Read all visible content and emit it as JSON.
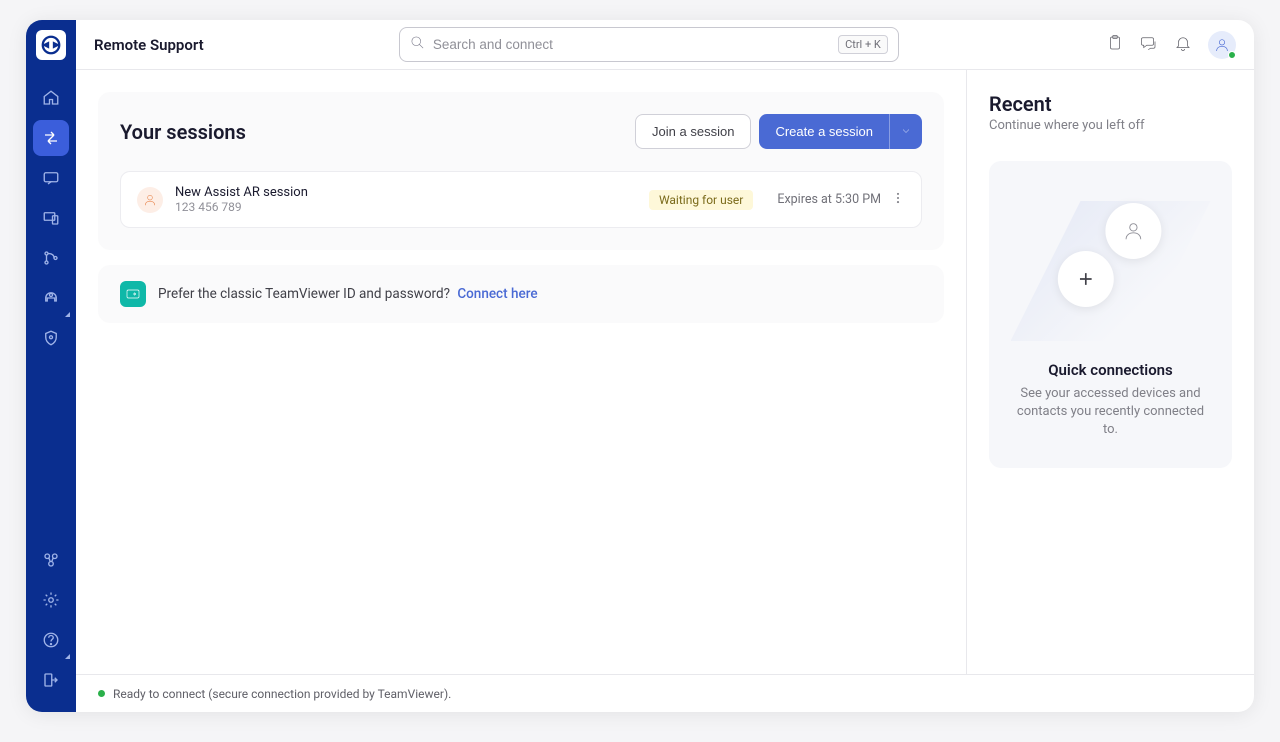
{
  "header": {
    "title": "Remote Support",
    "search_placeholder": "Search and connect",
    "shortcut": "Ctrl + K"
  },
  "sessions": {
    "title": "Your sessions",
    "join_label": "Join a session",
    "create_label": "Create a session",
    "items": [
      {
        "name": "New Assist AR session",
        "id": "123 456 789",
        "status": "Waiting for user",
        "expires": "Expires at 5:30 PM"
      }
    ]
  },
  "classic": {
    "prompt": "Prefer the classic TeamViewer ID and password?",
    "link": "Connect here"
  },
  "recent": {
    "title": "Recent",
    "subtitle": "Continue where you left off",
    "quick_title": "Quick connections",
    "quick_desc": "See your accessed devices and contacts you recently connected to."
  },
  "status": {
    "text": "Ready to connect (secure connection provided by TeamViewer)."
  },
  "colors": {
    "primary": "#4a6ad4",
    "sidebar": "#0a2e8f",
    "green": "#2ab04a",
    "badge_bg": "#fef8d9"
  }
}
